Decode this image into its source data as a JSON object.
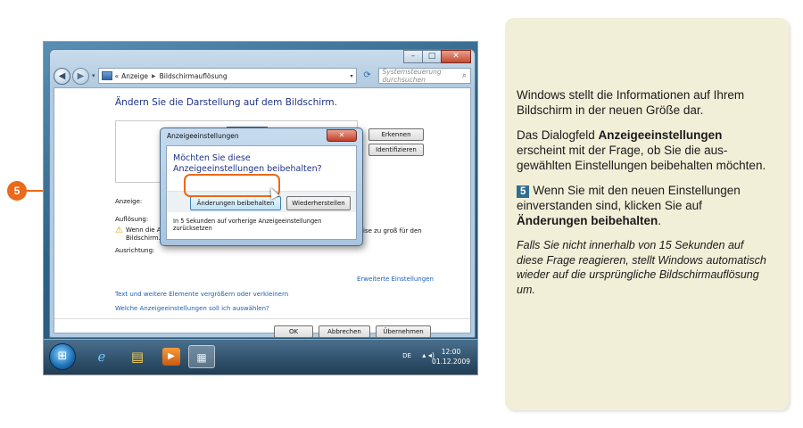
{
  "explorer": {
    "breadcrumb_prefix": "«",
    "breadcrumb_1": "Anzeige",
    "breadcrumb_2": "Bildschirmauflösung",
    "search_placeholder": "Systemsteuerung durchsuchen",
    "content_title": "Ändern Sie die Darstellung auf dem Bildschirm.",
    "detect_label": "Erkennen",
    "identify_label": "Identifizieren",
    "display_label": "Anzeige:",
    "resolution_label": "Auflösung:",
    "warning_left": "Wenn die A",
    "warning_left_2": "Bildschirm.",
    "warning_right": "ise zu groß für den",
    "orientation_label": "Ausrichtung:",
    "advanced_link": "Erweiterte Einstellungen",
    "text_size_link": "Text und weitere Elemente vergrößern oder verkleinern",
    "which_settings_link": "Welche Anzeigeeinstellungen soll ich auswählen?",
    "ok_label": "OK",
    "cancel_label": "Abbrechen",
    "apply_label": "Übernehmen"
  },
  "dialog": {
    "title": "Anzeigeeinstellungen",
    "question": "Möchten Sie diese Anzeigeeinstellungen beibehalten?",
    "keep_label": "Änderungen beibehalten",
    "revert_label": "Wiederherstellen",
    "countdown_line1": "In 5 Sekunden auf vorherige Anzeigeeinstellungen",
    "countdown_line2": "zurücksetzen"
  },
  "taskbar": {
    "language": "DE",
    "time": "12:00",
    "date": "01.12.2009"
  },
  "callout": {
    "number": "5",
    "color": "#e86a1a"
  },
  "panel": {
    "p1": "Windows stellt die Informationen auf Ihrem Bildschirm in der neuen Größe dar.",
    "p2_pre": "Das Dialogfeld ",
    "p2_bold": "Anzeigeeinstellungen",
    "p2_post": " erscheint mit der Frage, ob Sie die aus­gewählten Einstellungen beibehalten möchten.",
    "p3_num": "5",
    "p3_pre": "Wenn Sie mit den neuen Einstellun­gen einverstanden sind, klicken Sie auf ",
    "p3_bold": "Änderungen beibehalten",
    "p3_post": ".",
    "p4": "Falls Sie nicht innerhalb von 15 Sekunden auf diese Frage reagieren, stellt Windows automa­tisch wieder auf die ursprüngliche Bildschirm­auflösung um."
  }
}
